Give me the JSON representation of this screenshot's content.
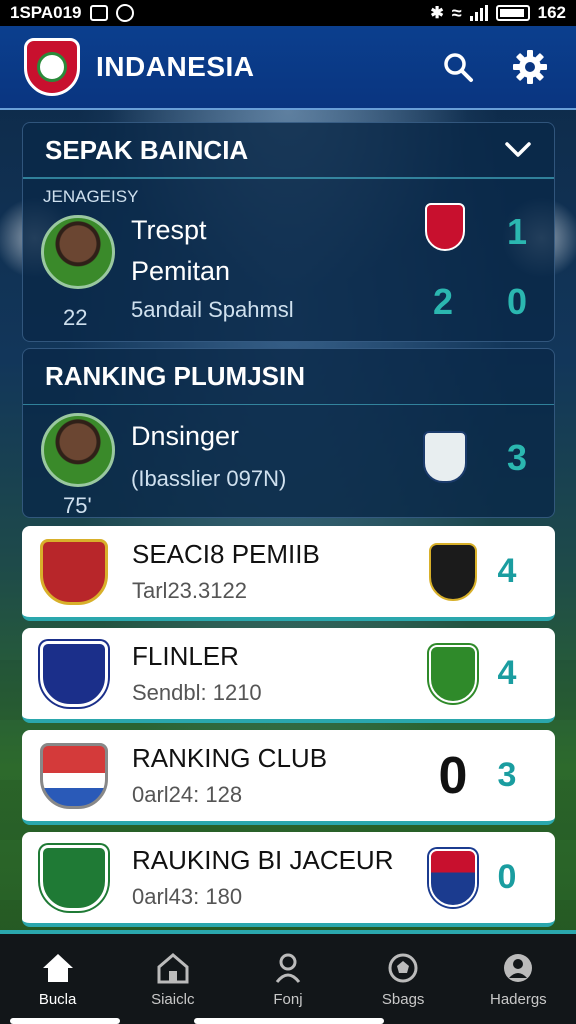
{
  "status_bar": {
    "time_left": "1SPA019",
    "time_right": "162"
  },
  "header": {
    "title": "INDANESIA"
  },
  "section_top": {
    "title": "SEPAK BAINCIA",
    "sub_label": "JENAGEISY",
    "player": {
      "name": "Trespt",
      "role": "Pemitan",
      "meta": "5andail Spahmsl",
      "jersey": "22"
    },
    "scores": [
      "1",
      "2",
      "0"
    ]
  },
  "section_ranking": {
    "title": "RANKING PLUMJSIN",
    "player": {
      "name": "Dnsinger",
      "meta": "(Ibasslier 097N)",
      "jersey": "75'"
    },
    "rank": "3"
  },
  "cards": [
    {
      "name": "SEACI8 PEMIIB",
      "sub": "Tarl23.3122",
      "score": "",
      "rank": "4",
      "crest_color": "#b8262a",
      "badge_color": "#1b1b1b"
    },
    {
      "name": "FLINLER",
      "sub": "Sendbl: 1210",
      "score": "",
      "rank": "4",
      "crest_color": "#1b2f8a",
      "badge_color": "#2f8a2a"
    },
    {
      "name": "RANKING CLUB",
      "sub": "0arl24: 128",
      "score": "0",
      "rank": "3",
      "crest_color": "#d43a3a",
      "badge_color": ""
    },
    {
      "name": "RAUKING BI JACEUR",
      "sub": "0arl43: 180",
      "score": "",
      "rank": "0",
      "crest_color": "#1f7a35",
      "badge_color": "#1b3b8f"
    }
  ],
  "nav": [
    {
      "label": "Bucla",
      "icon": "home-icon"
    },
    {
      "label": "Siaiclc",
      "icon": "stadium-icon"
    },
    {
      "label": "Fonj",
      "icon": "person-icon"
    },
    {
      "label": "Sbags",
      "icon": "ball-icon"
    },
    {
      "label": "Hadergs",
      "icon": "profile-icon"
    }
  ],
  "colors": {
    "header_blue": "#0b3f8e",
    "teal": "#2bb7b0",
    "red": "#c8102e"
  }
}
